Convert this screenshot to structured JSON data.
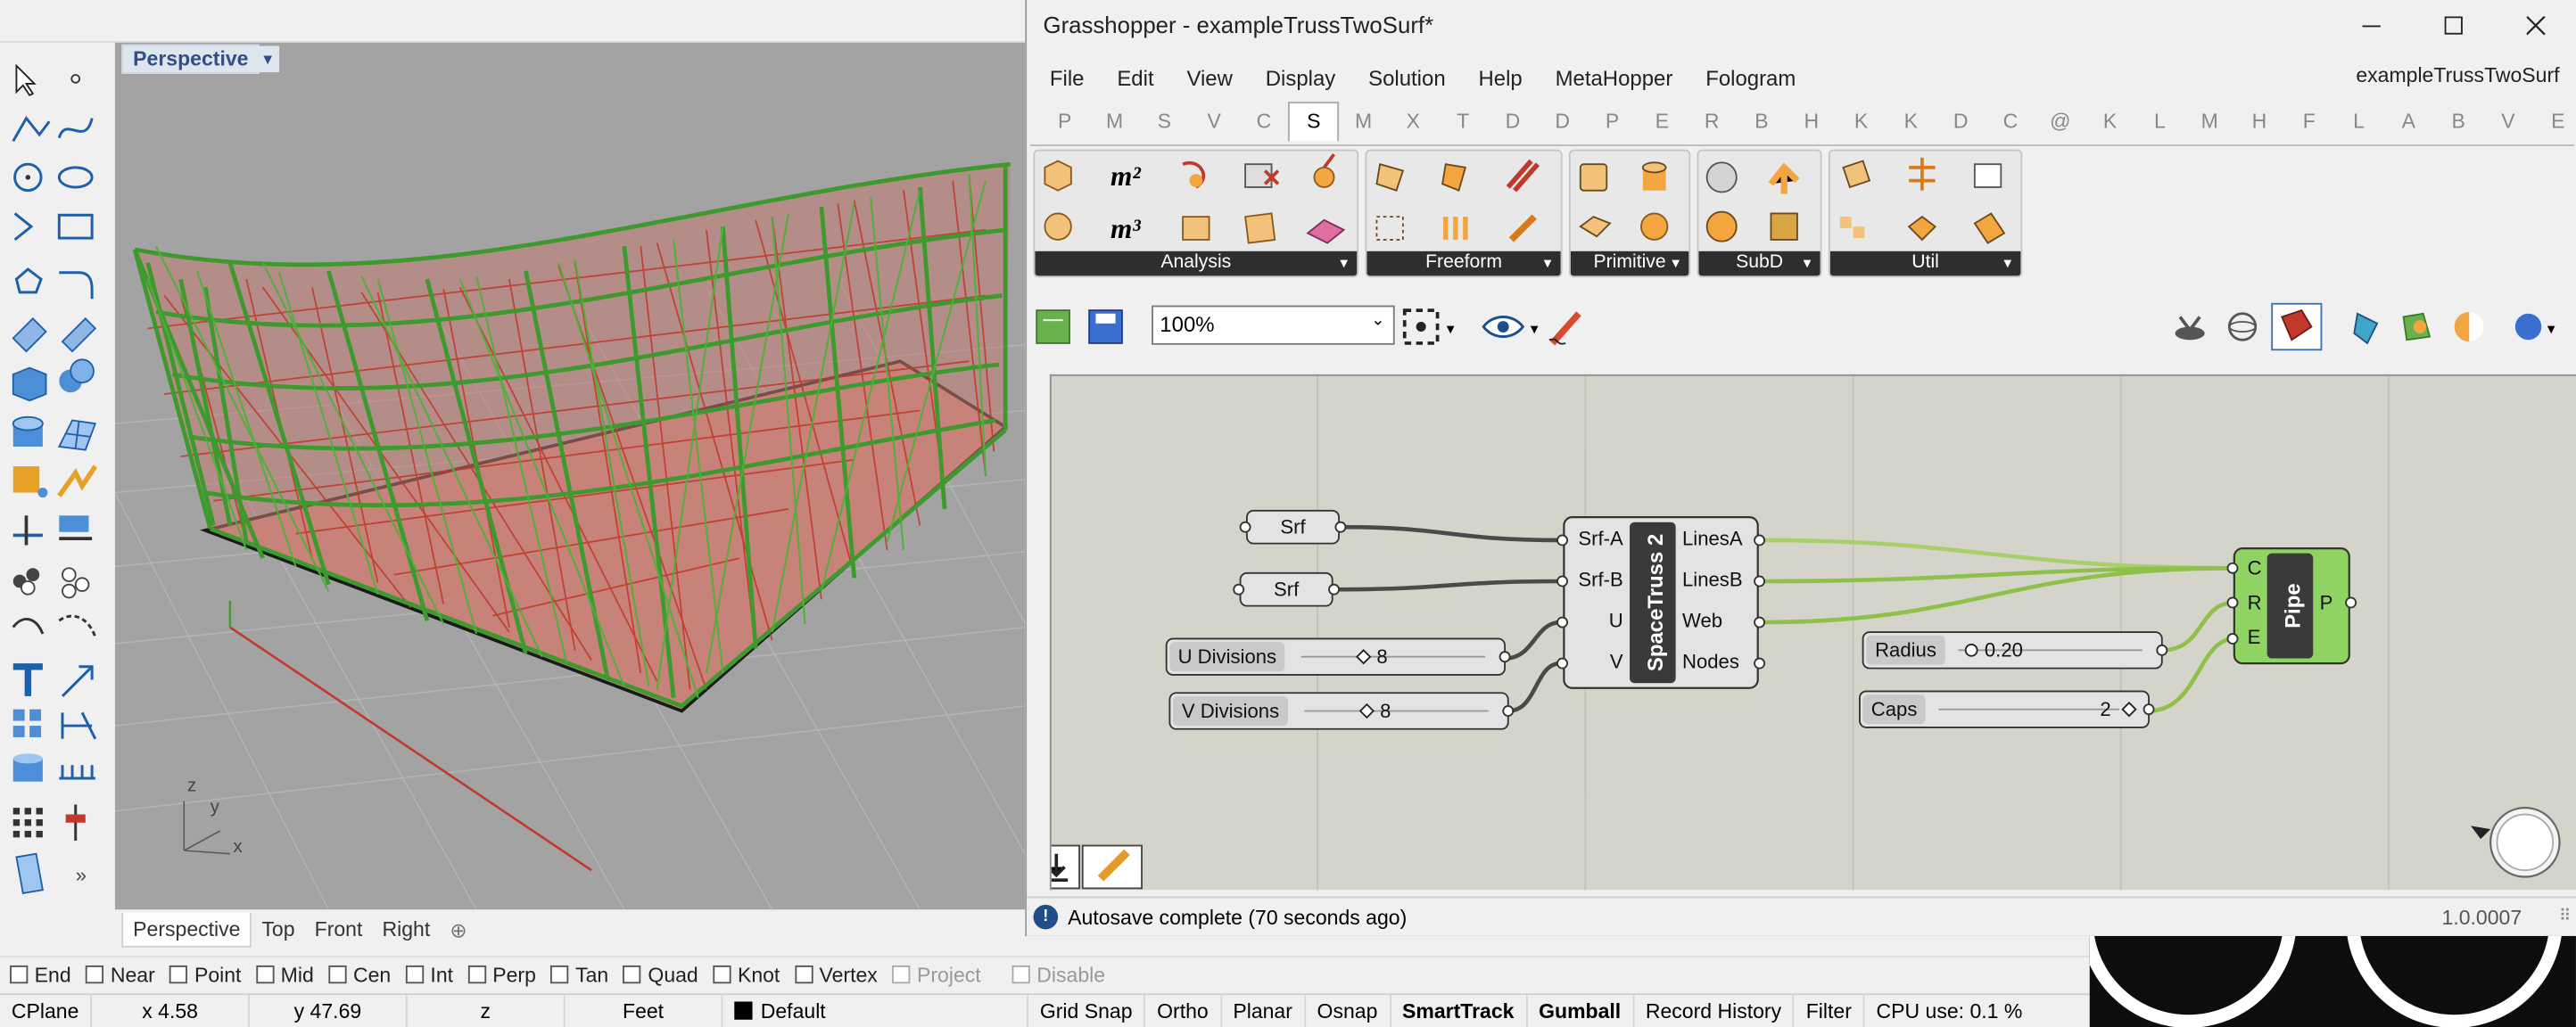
{
  "rhino": {
    "viewport": {
      "name": "Perspective",
      "axis_z": "z",
      "axis_y": "y",
      "axis_x": "x"
    },
    "view_tabs": [
      "Perspective",
      "Top",
      "Front",
      "Right"
    ],
    "add_tab_icon": "plus-icon",
    "more_tools_icon": "double-chevron-icon",
    "osnaps": [
      {
        "label": "End",
        "enabled": true
      },
      {
        "label": "Near",
        "enabled": true
      },
      {
        "label": "Point",
        "enabled": true
      },
      {
        "label": "Mid",
        "enabled": true
      },
      {
        "label": "Cen",
        "enabled": true
      },
      {
        "label": "Int",
        "enabled": true
      },
      {
        "label": "Perp",
        "enabled": true
      },
      {
        "label": "Tan",
        "enabled": true
      },
      {
        "label": "Quad",
        "enabled": true
      },
      {
        "label": "Knot",
        "enabled": true
      },
      {
        "label": "Vertex",
        "enabled": true
      },
      {
        "label": "Project",
        "enabled": false
      },
      {
        "label": "Disable",
        "enabled": false
      }
    ],
    "status": {
      "cplane": "CPlane",
      "x": "x 4.58",
      "y": "y 47.69",
      "z": "z",
      "units": "Feet",
      "layer": "Default",
      "layer_color": "#000000"
    },
    "status_toggles": [
      {
        "label": "Grid Snap",
        "bold": false
      },
      {
        "label": "Ortho",
        "bold": false
      },
      {
        "label": "Planar",
        "bold": false
      },
      {
        "label": "Osnap",
        "bold": false
      },
      {
        "label": "SmartTrack",
        "bold": true
      },
      {
        "label": "Gumball",
        "bold": true
      },
      {
        "label": "Record History",
        "bold": false
      },
      {
        "label": "Filter",
        "bold": false
      }
    ],
    "cpu": "CPU use: 0.1 %",
    "colors": {
      "viewport_bg": "#a3a3a3",
      "truss_green": "#3f9a2f",
      "surface_red": "#b04a3c",
      "grid": "#b7b7b7"
    }
  },
  "grasshopper": {
    "title": "Grasshopper - exampleTrussTwoSurf*",
    "doc_name": "exampleTrussTwoSurf",
    "menu": [
      "File",
      "Edit",
      "View",
      "Display",
      "Solution",
      "Help",
      "MetaHopper",
      "Fologram"
    ],
    "tabs": [
      "P",
      "M",
      "S",
      "V",
      "C",
      "S",
      "M",
      "X",
      "T",
      "D",
      "D",
      "P",
      "E",
      "R",
      "B",
      "H",
      "K",
      "K",
      "D",
      "C",
      "@",
      "K",
      "L",
      "M",
      "H",
      "F",
      "L",
      "A",
      "B",
      "V",
      "E"
    ],
    "active_tab": 5,
    "ribbon_groups": [
      "Analysis",
      "Freeform",
      "Primitive",
      "SubD",
      "Util"
    ],
    "zoom": "100%",
    "status": "Autosave complete (70 seconds ago)",
    "version": "1.0.0007",
    "canvas": {
      "srf1": "Srf",
      "srf2": "Srf",
      "u_label": "U Divisions",
      "u_value": "8",
      "v_label": "V Divisions",
      "v_value": "8",
      "truss_name": "SpaceTruss 2",
      "truss_inputs": [
        "Srf-A",
        "Srf-B",
        "U",
        "V"
      ],
      "truss_outputs": [
        "LinesA",
        "LinesB",
        "Web",
        "Nodes"
      ],
      "radius_label": "Radius",
      "radius_value": "0.20",
      "caps_label": "Caps",
      "caps_value": "2",
      "pipe_name": "Pipe",
      "pipe_inputs": [
        "C",
        "R",
        "E"
      ],
      "pipe_output": "P"
    },
    "colors": {
      "canvas": "#d4d4ca",
      "component": "#e3e3e3",
      "pipe": "#8fd462",
      "wire_green": "#8fc04a"
    }
  }
}
